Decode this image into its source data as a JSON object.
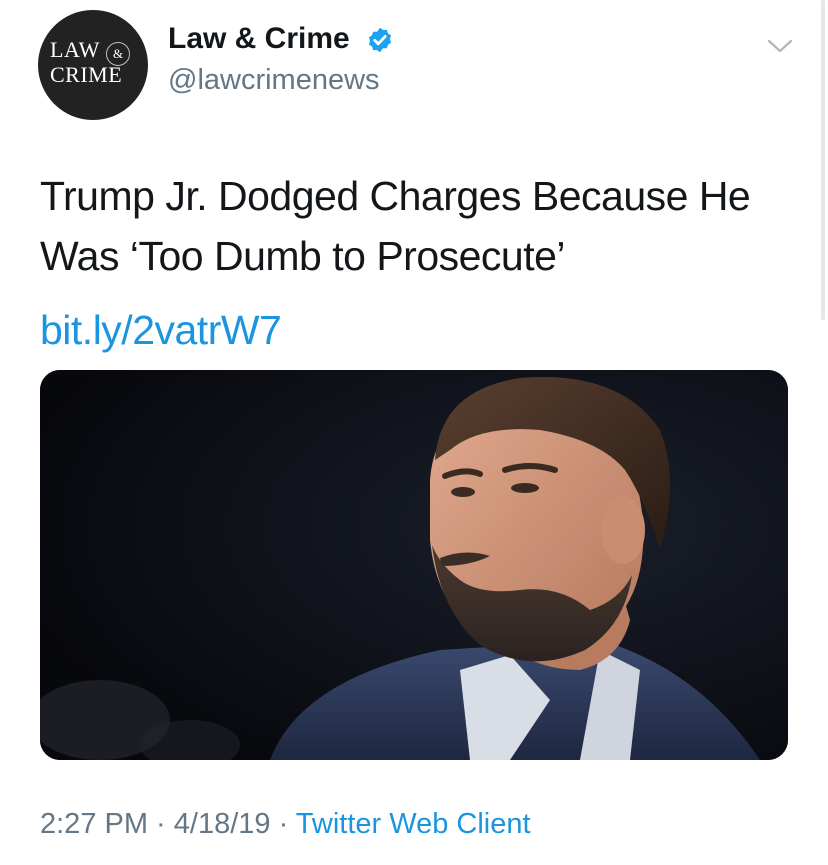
{
  "account": {
    "display_name": "Law & Crime",
    "handle": "@lawcrimenews",
    "avatar_logo": {
      "line1": "LAW",
      "amp": "&",
      "line2": "CRIME"
    },
    "verified": true
  },
  "tweet": {
    "text": "Trump Jr. Dodged Charges Because He Was ‘Too Dumb to Prosecute’",
    "link": "bit.ly/2vatrW7"
  },
  "meta": {
    "time": "2:27 PM",
    "separator1": " · ",
    "date": "4/18/19",
    "separator2": " · ",
    "client": "Twitter Web Client"
  },
  "colors": {
    "link_blue": "#1b95e0",
    "secondary_gray": "#657786",
    "text_dark": "#14171a",
    "verified_blue": "#1da1f2"
  },
  "icons": {
    "verified": "verified-badge-icon",
    "menu": "chevron-down-icon"
  }
}
